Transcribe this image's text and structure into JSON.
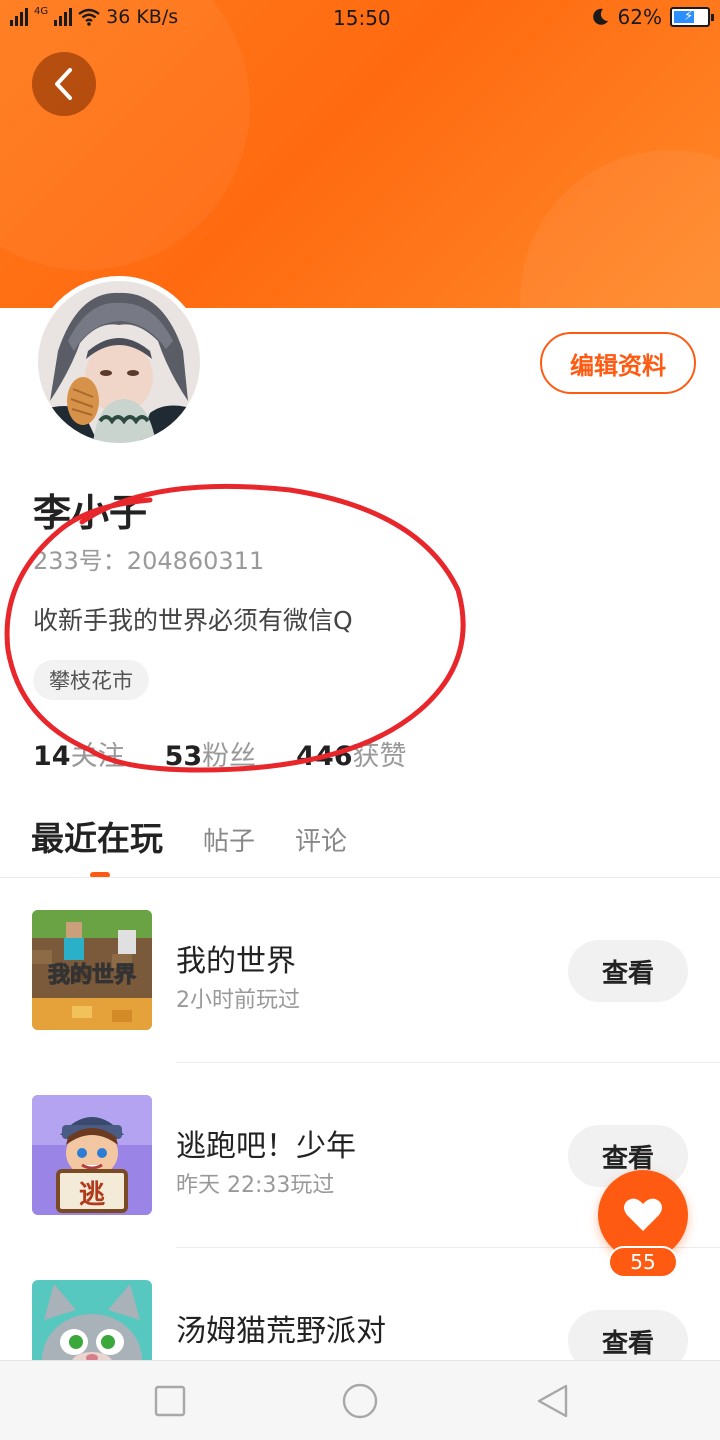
{
  "status_bar": {
    "network": "4G",
    "speed": "36 KB/s",
    "time": "15:50",
    "battery": "62%",
    "battery_level": 0.62
  },
  "profile": {
    "name": "李小子",
    "uid": "233号：204860311",
    "bio": "收新手我的世界必须有微信Q",
    "location": "攀枝花市",
    "edit_label": "编辑资料",
    "stats": [
      {
        "num": "14",
        "label": "关注"
      },
      {
        "num": "53",
        "label": "粉丝"
      },
      {
        "num": "446",
        "label": "获赞"
      }
    ]
  },
  "tabs": [
    {
      "label": "最近在玩",
      "active": true
    },
    {
      "label": "帖子",
      "active": false
    },
    {
      "label": "评论",
      "active": false
    }
  ],
  "games": [
    {
      "title": "我的世界",
      "sub": "2小时前玩过",
      "button": "查看",
      "icon_text": "我的世界"
    },
    {
      "title": "逃跑吧！少年",
      "sub": "昨天 22:33玩过",
      "button": "查看",
      "icon_text": "逃"
    },
    {
      "title": "汤姆猫荒野派对",
      "sub": "",
      "button": "查看",
      "icon_text": ""
    }
  ],
  "like": {
    "count": "55"
  },
  "colors": {
    "accent": "#ff5a12",
    "banner": "#ff7a1a",
    "annotation": "#e8272c"
  }
}
